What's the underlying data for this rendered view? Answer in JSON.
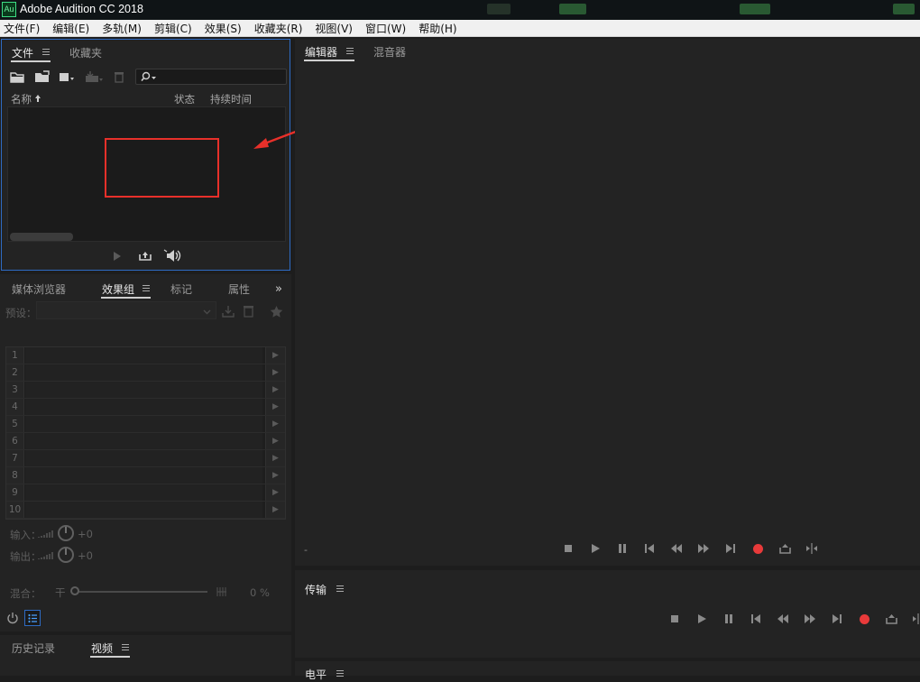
{
  "app": {
    "icon_text": "Au",
    "title": "Adobe Audition CC 2018"
  },
  "menu": [
    "文件(F)",
    "编辑(E)",
    "多轨(M)",
    "剪辑(C)",
    "效果(S)",
    "收藏夹(R)",
    "视图(V)",
    "窗口(W)",
    "帮助(H)"
  ],
  "files_panel": {
    "tabs": [
      "文件",
      "收藏夹"
    ],
    "columns": [
      "名称",
      "状态",
      "持续时间"
    ],
    "sort_icon": "sort-ascending-icon"
  },
  "effects_panel": {
    "tabs": [
      "媒体浏览器",
      "效果组",
      "标记",
      "属性"
    ],
    "preset_label": "预设：",
    "rack_slots": [
      "1",
      "2",
      "3",
      "4",
      "5",
      "6",
      "7",
      "8",
      "9",
      "10"
    ],
    "input_label": "输入：",
    "input_value": "+0",
    "output_label": "输出：",
    "output_value": "+0",
    "mix_label": "混合：",
    "mix_dry": "干",
    "mix_value": "0 %"
  },
  "history_panel": {
    "tabs": [
      "历史记录",
      "视频"
    ]
  },
  "editor_panel": {
    "tabs": [
      "编辑器",
      "混音器"
    ],
    "time_display": "-"
  },
  "transport_panel": {
    "title": "传输"
  },
  "levels_panel": {
    "title": "电平"
  },
  "colors": {
    "accent_focus": "#2e6bc4",
    "record": "#e83a3a",
    "annotation": "#e8302a"
  }
}
